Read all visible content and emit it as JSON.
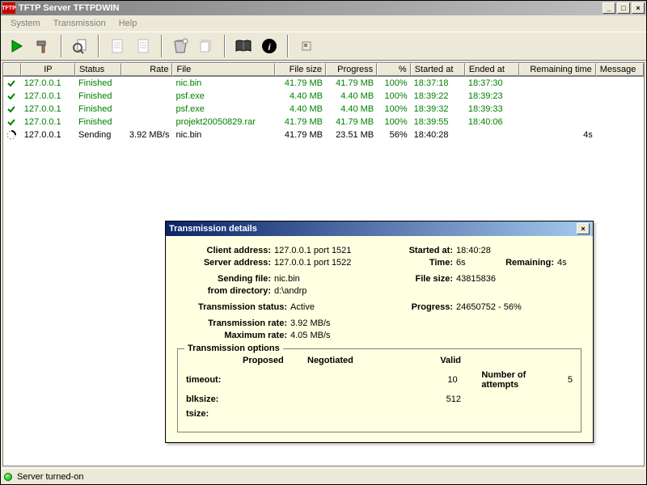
{
  "window": {
    "title": "TFTP Server TFTPDWIN",
    "icon_text": "TFTP"
  },
  "menu": {
    "system": "System",
    "transmission": "Transmission",
    "help": "Help"
  },
  "columns": {
    "ip": "IP",
    "status": "Status",
    "rate": "Rate",
    "file": "File",
    "file_size": "File size",
    "progress": "Progress",
    "pct": "%",
    "started": "Started at",
    "ended": "Ended at",
    "remaining": "Remaining time",
    "message": "Message"
  },
  "rows": [
    {
      "state": "done",
      "ip": "127.0.0.1",
      "status": "Finished",
      "rate": "",
      "file": "nic.bin",
      "size": "41.79 MB",
      "progress": "41.79 MB",
      "pct": "100%",
      "started": "18:37:18",
      "ended": "18:37:30",
      "remaining": "",
      "msg": ""
    },
    {
      "state": "done",
      "ip": "127.0.0.1",
      "status": "Finished",
      "rate": "",
      "file": "psf.exe",
      "size": "4.40 MB",
      "progress": "4.40 MB",
      "pct": "100%",
      "started": "18:39:22",
      "ended": "18:39:23",
      "remaining": "",
      "msg": ""
    },
    {
      "state": "done",
      "ip": "127.0.0.1",
      "status": "Finished",
      "rate": "",
      "file": "psf.exe",
      "size": "4.40 MB",
      "progress": "4.40 MB",
      "pct": "100%",
      "started": "18:39:32",
      "ended": "18:39:33",
      "remaining": "",
      "msg": ""
    },
    {
      "state": "done",
      "ip": "127.0.0.1",
      "status": "Finished",
      "rate": "",
      "file": "projekt20050829.rar",
      "size": "41.79 MB",
      "progress": "41.79 MB",
      "pct": "100%",
      "started": "18:39:55",
      "ended": "18:40:06",
      "remaining": "",
      "msg": ""
    },
    {
      "state": "active",
      "ip": "127.0.0.1",
      "status": "Sending",
      "rate": "3.92 MB/s",
      "file": "nic.bin",
      "size": "41.79 MB",
      "progress": "23.51 MB",
      "pct": "56%",
      "started": "18:40:28",
      "ended": "",
      "remaining": "4s",
      "msg": ""
    }
  ],
  "dialog": {
    "title": "Transmission details",
    "labels": {
      "client": "Client address:",
      "server": "Server address:",
      "started": "Started at:",
      "time": "Time:",
      "remaining": "Remaining:",
      "sending_file": "Sending file:",
      "from_dir": "from directory:",
      "file_size": "File size:",
      "status": "Transmission status:",
      "progress": "Progress:",
      "rate": "Transmission rate:",
      "max_rate": "Maximum rate:",
      "options_legend": "Transmission options",
      "proposed": "Proposed",
      "negotiated": "Negotiated",
      "valid": "Valid",
      "timeout": "timeout:",
      "blksize": "blksize:",
      "tsize": "tsize:",
      "attempts": "Number of attempts"
    },
    "values": {
      "client": "127.0.0.1 port 1521",
      "server": "127.0.0.1 port 1522",
      "started": "18:40:28",
      "time": "6s",
      "remaining": "4s",
      "sending_file": "nic.bin",
      "from_dir": "d:\\andrp",
      "file_size": "43815836",
      "status": "Active",
      "progress": "24650752 - 56%",
      "rate": "3.92 MB/s",
      "max_rate": "4.05 MB/s",
      "timeout_valid": "10",
      "blksize_valid": "512",
      "attempts": "5"
    }
  },
  "status": {
    "text": "Server turned-on"
  }
}
